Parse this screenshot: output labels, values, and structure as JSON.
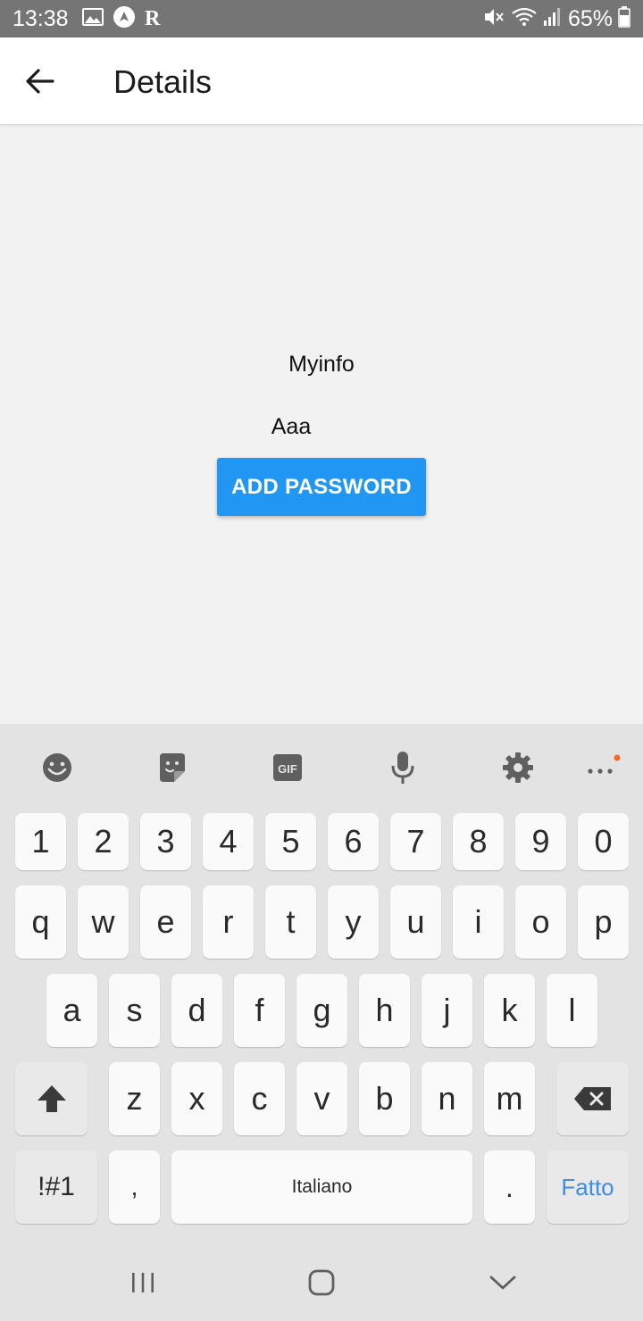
{
  "status_bar": {
    "time": "13:38",
    "left_icons": [
      "image-icon",
      "navigation-icon"
    ],
    "r_label": "R",
    "right_icons": [
      "mute-icon",
      "wifi-icon",
      "signal-icon"
    ],
    "battery_percent": "65%"
  },
  "app_bar": {
    "back_icon": "arrow-back-icon",
    "title": "Details"
  },
  "content": {
    "title": "Myinfo",
    "item": "Aaa",
    "add_button_label": "ADD PASSWORD"
  },
  "keyboard": {
    "toolbar_icons": [
      "emoji-icon",
      "sticker-icon",
      "gif-icon",
      "microphone-icon",
      "settings-icon",
      "more-icon"
    ],
    "gif_label": "GIF",
    "rows": {
      "numbers": [
        "1",
        "2",
        "3",
        "4",
        "5",
        "6",
        "7",
        "8",
        "9",
        "0"
      ],
      "row1": [
        "q",
        "w",
        "e",
        "r",
        "t",
        "y",
        "u",
        "i",
        "o",
        "p"
      ],
      "row2": [
        "a",
        "s",
        "d",
        "f",
        "g",
        "h",
        "j",
        "k",
        "l"
      ],
      "row3": [
        "z",
        "x",
        "c",
        "v",
        "b",
        "n",
        "m"
      ]
    },
    "symbols_label": "!#1",
    "comma_label": ",",
    "space_label": "Italiano",
    "period_label": ".",
    "done_label": "Fatto",
    "accent_color": "#3d8ee0"
  },
  "nav_bar": {
    "icons": [
      "recent-apps-icon",
      "home-icon",
      "back-chevron-icon"
    ]
  },
  "colors": {
    "status_bar": "#757575",
    "primary_button": "#2196f3",
    "background": "#f2f2f2",
    "keyboard": "#e3e3e3"
  }
}
